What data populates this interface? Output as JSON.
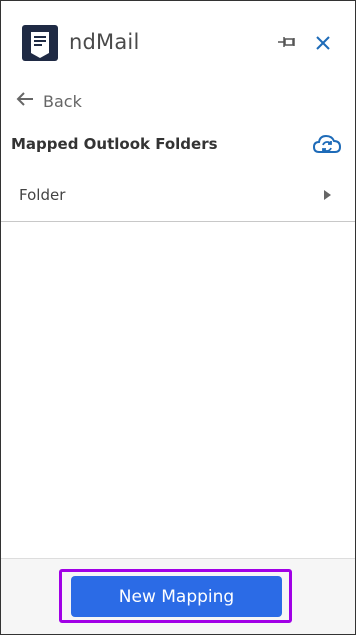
{
  "app": {
    "title": "ndMail"
  },
  "header": {
    "pin_icon": "pin-icon",
    "close_icon": "close-icon"
  },
  "nav": {
    "back_label": "Back"
  },
  "section": {
    "title": "Mapped Outlook Folders",
    "sync_icon": "cloud-sync-icon"
  },
  "folders": [
    {
      "label": "Folder"
    }
  ],
  "footer": {
    "new_mapping_label": "New Mapping"
  },
  "colors": {
    "accent": "#2b6be6",
    "logo_bg": "#1f2a44",
    "highlight": "#a100e6",
    "icon_blue": "#1e6bb8"
  }
}
